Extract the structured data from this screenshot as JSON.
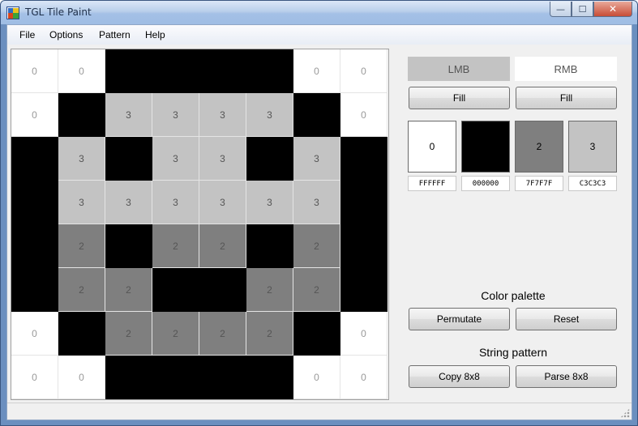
{
  "window": {
    "title": "TGL Tile Paint",
    "controls": {
      "minimize": "—",
      "maximize": "☐",
      "close": "✕"
    }
  },
  "menu": [
    "File",
    "Options",
    "Pattern",
    "Help"
  ],
  "palette_colors": [
    "#FFFFFF",
    "#000000",
    "#7F7F7F",
    "#C3C3C3"
  ],
  "palette_text_colors": [
    "#999999",
    "#000000",
    "#555555",
    "#555555"
  ],
  "tile": {
    "rows": [
      [
        0,
        0,
        1,
        1,
        1,
        1,
        0,
        0
      ],
      [
        0,
        1,
        3,
        3,
        3,
        3,
        1,
        0
      ],
      [
        1,
        3,
        1,
        3,
        3,
        1,
        3,
        1
      ],
      [
        1,
        3,
        3,
        3,
        3,
        3,
        3,
        1
      ],
      [
        1,
        2,
        1,
        2,
        2,
        1,
        2,
        1
      ],
      [
        1,
        2,
        2,
        1,
        1,
        2,
        2,
        1
      ],
      [
        0,
        1,
        2,
        2,
        2,
        2,
        1,
        0
      ],
      [
        0,
        0,
        1,
        1,
        1,
        1,
        0,
        0
      ]
    ],
    "cell_labels": [
      "0",
      "",
      "2",
      "3"
    ]
  },
  "mouse": {
    "lmb_label": "LMB",
    "rmb_label": "RMB",
    "lmb_fill": "Fill",
    "rmb_fill": "Fill",
    "lmb_active_color": "#C3C3C3",
    "rmb_active_color": "#FFFFFF"
  },
  "palette": {
    "swatches": [
      {
        "label": "0",
        "hex": "FFFFFF",
        "color": "#FFFFFF"
      },
      {
        "label": "",
        "hex": "000000",
        "color": "#000000"
      },
      {
        "label": "2",
        "hex": "7F7F7F",
        "color": "#7F7F7F"
      },
      {
        "label": "3",
        "hex": "C3C3C3",
        "color": "#C3C3C3"
      }
    ],
    "title": "Color palette",
    "permutate": "Permutate",
    "reset": "Reset"
  },
  "pattern": {
    "title": "String pattern",
    "copy": "Copy 8x8",
    "parse": "Parse 8x8"
  }
}
